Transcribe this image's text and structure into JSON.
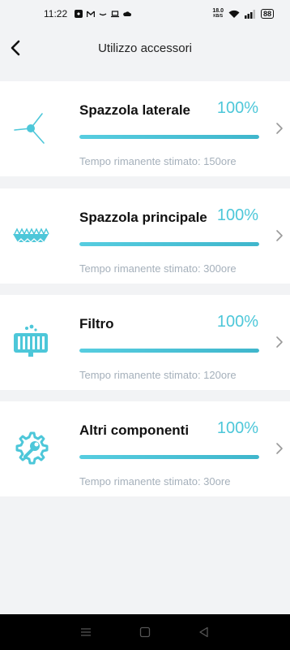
{
  "status_bar": {
    "time": "11:22",
    "net_speed_value": "18.0",
    "net_speed_unit": "KB/S",
    "battery": "88"
  },
  "header": {
    "title": "Utilizzo accessori"
  },
  "accessories": [
    {
      "name": "Spazzola laterale",
      "percent_label": "100%",
      "percent": 100,
      "remaining": "Tempo rimanente stimato: 150ore",
      "icon": "side-brush-icon"
    },
    {
      "name": "Spazzola principale",
      "percent_label": "100%",
      "percent": 100,
      "remaining": "Tempo rimanente stimato: 300ore",
      "icon": "main-brush-icon"
    },
    {
      "name": "Filtro",
      "percent_label": "100%",
      "percent": 100,
      "remaining": "Tempo rimanente stimato: 120ore",
      "icon": "filter-icon"
    },
    {
      "name": "Altri componenti",
      "percent_label": "100%",
      "percent": 100,
      "remaining": "Tempo rimanente stimato: 30ore",
      "icon": "wrench-gear-icon"
    }
  ],
  "colors": {
    "accent": "#4dc7d9",
    "background": "#f2f3f5",
    "muted_text": "#a5b0bb"
  }
}
